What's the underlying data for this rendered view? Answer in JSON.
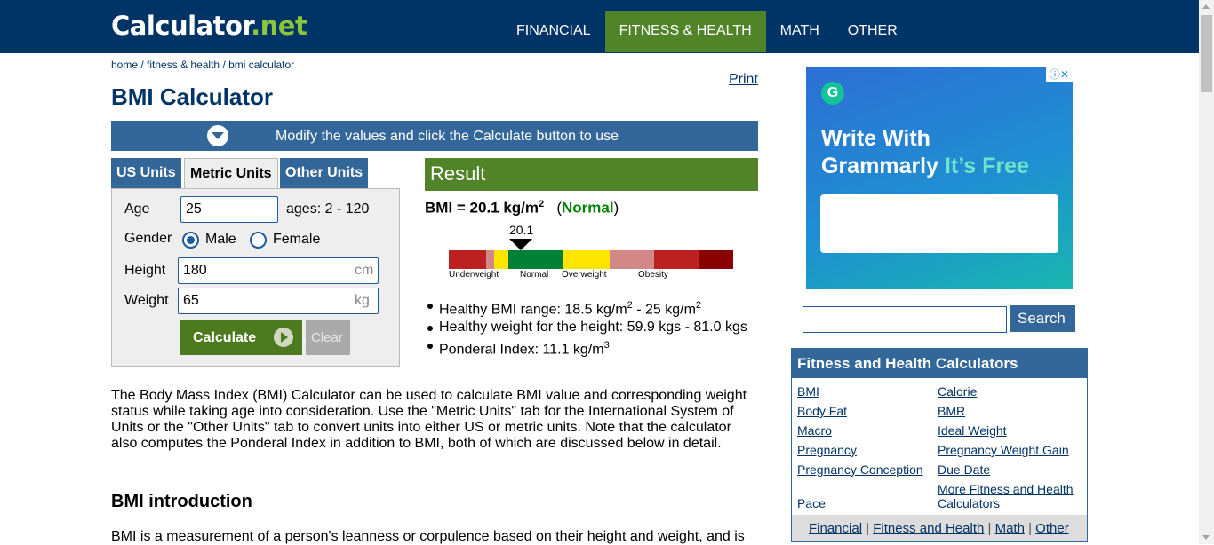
{
  "header": {
    "logo_main": "Calculator",
    "logo_dot": ".",
    "logo_net": "net",
    "nav": [
      "FINANCIAL",
      "FITNESS & HEALTH",
      "MATH",
      "OTHER"
    ]
  },
  "breadcrumb": {
    "home": "home",
    "sep1": " / ",
    "fitness": "fitness & health",
    "sep2": " / ",
    "current": "bmi calculator"
  },
  "page_title": "BMI Calculator",
  "print_label": "Print",
  "modify_text": "Modify the values and click the Calculate button to use",
  "tabs": [
    "US Units",
    "Metric Units",
    "Other Units"
  ],
  "form": {
    "age_label": "Age",
    "age_value": "25",
    "age_hint": "ages: 2 - 120",
    "gender_label": "Gender",
    "male_label": "Male",
    "female_label": "Female",
    "height_label": "Height",
    "height_value": "180",
    "height_unit": "cm",
    "weight_label": "Weight",
    "weight_value": "65",
    "weight_unit": "kg",
    "calculate_label": "Calculate",
    "clear_label": "Clear"
  },
  "result": {
    "header": "Result",
    "bmi_text": "BMI = 20.1 kg/m",
    "bmi_sup": "2",
    "status_open": "(",
    "status": "Normal",
    "status_close": ")",
    "gauge_value": "20.1",
    "gauge_labels": [
      "Underweight",
      "Normal",
      "Overweight",
      "Obesity"
    ],
    "gauge_colors": [
      "#bc2020",
      "#d38888",
      "#ffe400",
      "#008137",
      "#ffe400",
      "#d38888",
      "#bc2020",
      "#8a0101"
    ],
    "healthy_range_prefix": "Healthy BMI range: 18.5 kg/m",
    "healthy_range_mid": " - 25 kg/m",
    "healthy_weight": "Healthy weight for the height: 59.9 kgs - 81.0 kgs",
    "ponderal_prefix": "Ponderal Index: 11.1 kg/m",
    "sup2": "2",
    "sup3": "3"
  },
  "description": "The Body Mass Index (BMI) Calculator can be used to calculate BMI value and corresponding weight status while taking age into consideration. Use the \"Metric Units\" tab for the International System of Units or the \"Other Units\" tab to convert units into either US or metric units. Note that the calculator also computes the Ponderal Index in addition to BMI, both of which are discussed below in detail.",
  "intro_heading": "BMI introduction",
  "intro_text": "BMI is a measurement of a person's leanness or corpulence based on their height and weight, and is",
  "ad": {
    "logo_letter": "G",
    "icons": "ⓘ✕",
    "line1": "Write With",
    "line2_main": "Grammarly ",
    "line2_free": "It’s Free"
  },
  "search": {
    "button_label": "Search"
  },
  "fh": {
    "header": "Fitness and Health Calculators",
    "links_left": [
      "BMI",
      "Body Fat",
      "Macro",
      "Pregnancy",
      "Pregnancy Conception",
      "Pace"
    ],
    "links_right": [
      "Calorie",
      "BMR",
      "Ideal Weight",
      "Pregnancy Weight Gain",
      "Due Date",
      "More Fitness and Health Calculators"
    ],
    "footer": [
      "Financial",
      "Fitness and Health",
      "Math",
      "Other"
    ],
    "footer_sep": " | "
  }
}
